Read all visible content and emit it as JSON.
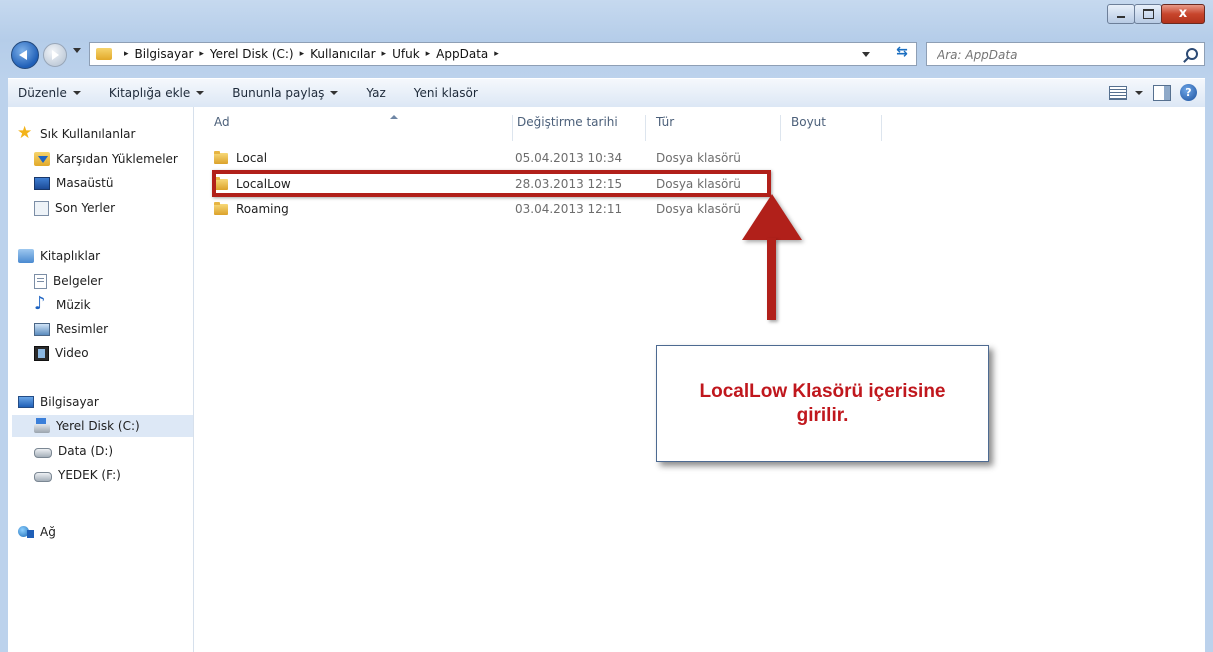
{
  "window": {
    "caption": {
      "minimize": "",
      "maximize": "",
      "close": "x"
    }
  },
  "address_bar": {
    "breadcrumbs": [
      "Bilgisayar",
      "Yerel Disk (C:)",
      "Kullanıcılar",
      "Ufuk",
      "AppData"
    ],
    "separator": "▸"
  },
  "search": {
    "placeholder": "Ara: AppData"
  },
  "command_bar": {
    "organize": "Düzenle",
    "include_in_library": "Kitaplığa ekle",
    "share_with": "Bununla paylaş",
    "burn": "Yaz",
    "new_folder": "Yeni klasör",
    "help": "?"
  },
  "nav_pane": {
    "favorites": {
      "label": "Sık Kullanılanlar",
      "items": [
        "Karşıdan Yüklemeler",
        "Masaüstü",
        "Son Yerler"
      ]
    },
    "libraries": {
      "label": "Kitaplıklar",
      "items": [
        "Belgeler",
        "Müzik",
        "Resimler",
        "Video"
      ]
    },
    "computer": {
      "label": "Bilgisayar",
      "items": [
        "Yerel Disk (C:)",
        "Data (D:)",
        "YEDEK (F:)"
      ],
      "selected": "Yerel Disk (C:)"
    },
    "network": {
      "label": "Ağ"
    }
  },
  "file_list": {
    "columns": [
      "Ad",
      "Değiştirme tarihi",
      "Tür",
      "Boyut"
    ],
    "rows": [
      {
        "name": "Local",
        "modified": "05.04.2013 10:34",
        "type": "Dosya klasörü"
      },
      {
        "name": "LocalLow",
        "modified": "28.03.2013 12:15",
        "type": "Dosya klasörü"
      },
      {
        "name": "Roaming",
        "modified": "03.04.2013 12:11",
        "type": "Dosya klasörü"
      }
    ]
  },
  "annotation": {
    "callout_text": "LocalLow Klasörü içerisine girilir.",
    "color": "#b1201a"
  }
}
